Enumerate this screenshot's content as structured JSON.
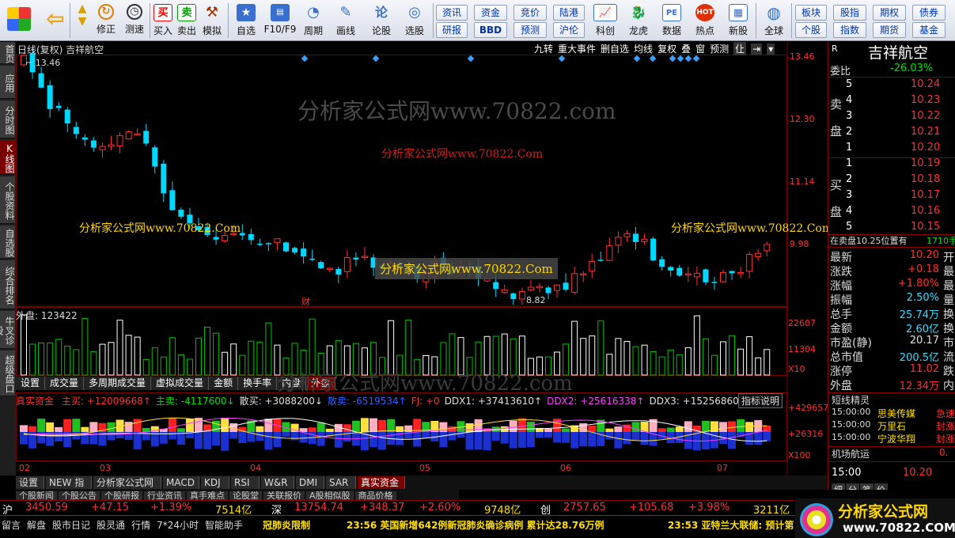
{
  "toolbar": {
    "buttons": [
      {
        "label": "修正",
        "icon": "refresh-icon"
      },
      {
        "label": "测速",
        "icon": "clock-icon"
      },
      {
        "label": "买入",
        "icon": "buy-icon"
      },
      {
        "label": "卖出",
        "icon": "sell-icon"
      },
      {
        "label": "模拟",
        "icon": "hammer-icon"
      },
      {
        "label": "自选",
        "icon": "star-icon"
      },
      {
        "label": "F10/F9",
        "icon": "f10-icon"
      },
      {
        "label": "周期",
        "icon": "period-icon"
      },
      {
        "label": "画线",
        "icon": "pen-icon"
      },
      {
        "label": "论股",
        "icon": "discuss-icon"
      },
      {
        "label": "选股",
        "icon": "select-icon"
      },
      {
        "label": "科创",
        "icon": "tech-icon"
      },
      {
        "label": "龙虎",
        "icon": "dragon-icon"
      },
      {
        "label": "数据",
        "icon": "data-icon"
      },
      {
        "label": "热点",
        "icon": "hot-icon"
      },
      {
        "label": "新股",
        "icon": "newstock-icon"
      },
      {
        "label": "全球",
        "icon": "globe-icon"
      }
    ],
    "quick": [
      "资讯",
      "资金",
      "竞价",
      "陆港",
      "研报",
      "BBD",
      "预测",
      "沪伦",
      "板块",
      "股指",
      "期权",
      "债券",
      "个股",
      "指数",
      "期货",
      "基金"
    ],
    "buy_glyph": "买",
    "sell_glyph": "卖",
    "news_glyph": "论",
    "pe_glyph": "PE",
    "hot_glyph": "HOT"
  },
  "left_tabs": [
    {
      "label": "首页",
      "active": false
    },
    {
      "label": "应用",
      "active": false
    },
    {
      "label": "分时图",
      "active": false
    },
    {
      "label": "K线图",
      "active": true
    },
    {
      "label": "个股资料",
      "active": false
    },
    {
      "label": "自选股",
      "active": false
    },
    {
      "label": "综合排名",
      "active": false
    },
    {
      "label": "牛叉诊股",
      "active": false
    },
    {
      "label": "超级盘口",
      "active": false
    }
  ],
  "chart": {
    "title": "日线(复权) 吉祥航空",
    "high_marker": "13.46",
    "low_marker": "8.82",
    "cai_marker": "财",
    "top_menu": [
      "九转",
      "重大事件",
      "删自选",
      "均线",
      "复权",
      "叠",
      "窗",
      "预测",
      "仩",
      "⇥",
      "▾"
    ],
    "price_axis": [
      "13.46",
      "12.30",
      "11.14",
      "9.98"
    ],
    "volume_label": "外盘: 123422",
    "volume_axis": [
      "22607",
      "11304"
    ],
    "volume_unit": "X10",
    "sub_tabs": [
      "设置",
      "成交量",
      "多周期成交量",
      "虚拟成交量",
      "金额",
      "换手率",
      "内盘",
      "外盘"
    ],
    "active_sub_tab": "外盘",
    "ind_title": "真实资金",
    "ind_values": [
      {
        "text": "主买: +12009668↑",
        "color": "#ff3030"
      },
      {
        "text": "主卖: -4117600↓",
        "color": "#00e000"
      },
      {
        "text": "散买: +3088200↓",
        "color": "#e0e0e0"
      },
      {
        "text": "散卖: -6519534↑",
        "color": "#3060ff"
      },
      {
        "text": "FJ: +0",
        "color": "#ff3030"
      },
      {
        "text": "DDX1: +37413610↑",
        "color": "#e0e0e0"
      },
      {
        "text": "DDX2: +25616338↑",
        "color": "#ff40ff"
      },
      {
        "text": "DDX3: +15256860↑",
        "color": "#e0e0e0"
      }
    ],
    "ind_help": "指标说明",
    "ind_axis": [
      "+429657",
      "+26316"
    ],
    "ind_unit": "X100",
    "x_axis": [
      "02",
      "03",
      "04",
      "05",
      "06",
      "07"
    ],
    "watermarks": [
      "分析家公式网www.70822.com",
      "分析家公式网www.70822.Com",
      "分析家公式网www.70822.Com",
      "分析家公式网www.70822.Com",
      "分析家公式网www.70822.Com",
      "分析家公式网www.70822.com"
    ]
  },
  "bottom_tabs": [
    {
      "label": "设置",
      "active": false
    },
    {
      "label": "NEW 指标平台",
      "active": false
    },
    {
      "label": "分析家公式网",
      "active": false
    },
    {
      "label": "MACD",
      "active": false
    },
    {
      "label": "KDJ",
      "active": false
    },
    {
      "label": "RSI",
      "active": false
    },
    {
      "label": "W&R",
      "active": false
    },
    {
      "label": "DMI",
      "active": false
    },
    {
      "label": "SAR",
      "active": false
    },
    {
      "label": "真实资金",
      "active": true
    }
  ],
  "bottom_tabs2": [
    "个股新闻",
    "个股公告",
    "个股研报",
    "行业资讯",
    "真手难点",
    "论股堂",
    "关联报价",
    "A股相似股",
    "商品价格"
  ],
  "quote": {
    "name": "吉祥航空",
    "code_mark": "R",
    "weibi_label": "委比",
    "weibi": "-26.03%",
    "sell_label": "卖盘",
    "buy_label": "买盘",
    "asks": [
      {
        "n": "5",
        "p": "10.24"
      },
      {
        "n": "4",
        "p": "10.23"
      },
      {
        "n": "3",
        "p": "10.22"
      },
      {
        "n": "2",
        "p": "10.21"
      },
      {
        "n": "1",
        "p": "10.20"
      }
    ],
    "bids": [
      {
        "n": "1",
        "p": "10.19"
      },
      {
        "n": "2",
        "p": "10.18"
      },
      {
        "n": "3",
        "p": "10.17"
      },
      {
        "n": "4",
        "p": "10.16"
      },
      {
        "n": "5",
        "p": "10.15"
      }
    ],
    "order_note": "在卖盘10.25位置有",
    "order_qty": "1710手",
    "stats": [
      {
        "k": "最新",
        "v": "10.20",
        "c": "#ff3030",
        "r": "开"
      },
      {
        "k": "涨跌",
        "v": "+0.18",
        "c": "#ff3030",
        "r": "最"
      },
      {
        "k": "涨幅",
        "v": "+1.80%",
        "c": "#ff3030",
        "r": "最"
      },
      {
        "k": "振幅",
        "v": "2.50%",
        "c": "#30e0ff",
        "r": "量"
      },
      {
        "k": "总手",
        "v": "25.74万",
        "c": "#30e0ff",
        "r": "换"
      },
      {
        "k": "金额",
        "v": "2.60亿",
        "c": "#30e0ff",
        "r": "换"
      },
      {
        "k": "市盈(静)",
        "v": "20.17",
        "c": "#e0e0e0",
        "r": "市"
      },
      {
        "k": "总市值",
        "v": "200.5亿",
        "c": "#30e0ff",
        "r": "流"
      },
      {
        "k": "涨停",
        "v": "11.02",
        "c": "#ff3030",
        "r": "跌"
      },
      {
        "k": "外盘",
        "v": "12.34万",
        "c": "#ff3030",
        "r": "内"
      }
    ],
    "news_title": "短线精灵",
    "news": [
      {
        "t": "15:00:00",
        "n": "思美传媒",
        "s": "急速"
      },
      {
        "t": "15:00:00",
        "n": "万里石",
        "s": "封涨"
      },
      {
        "t": "15:00:00",
        "n": "宁波华翔",
        "s": "封涨"
      }
    ],
    "sector": "机场航运",
    "sector_val": "0.",
    "tick_time": "15:00",
    "tick_price": "10.20",
    "tick_tabs": [
      "细",
      "分",
      "笔",
      "价"
    ]
  },
  "index_bar": [
    {
      "name": "沪",
      "val": "3450.59",
      "chg": "+47.15",
      "pct": "+1.39%",
      "amt": "7514亿"
    },
    {
      "name": "深",
      "val": "13754.74",
      "chg": "+348.37",
      "pct": "+2.60%",
      "amt": "9748亿"
    },
    {
      "name": "创",
      "val": "2757.65",
      "chg": "+105.68",
      "pct": "+3.98%",
      "amt": "3211亿"
    }
  ],
  "status_bar": {
    "items": [
      "留言",
      "解盘",
      "股市日记",
      "股灵通",
      "行情",
      "7*24小时",
      "智能助手"
    ],
    "tag": "冠肺炎限制",
    "news1": "23:56 英国新增642例新冠肺炎确诊病例 累计达28.76万例",
    "news2": "23:53 亚特兰大联储: 预计第",
    "logo": "分析家公式网",
    "logo_url": "www.70822.COM"
  },
  "colors": {
    "up": "#ff3030",
    "down": "#00d8ff",
    "vol_up": "#ffffff",
    "vol_down": "#00c000",
    "grid": "#7a0000"
  }
}
